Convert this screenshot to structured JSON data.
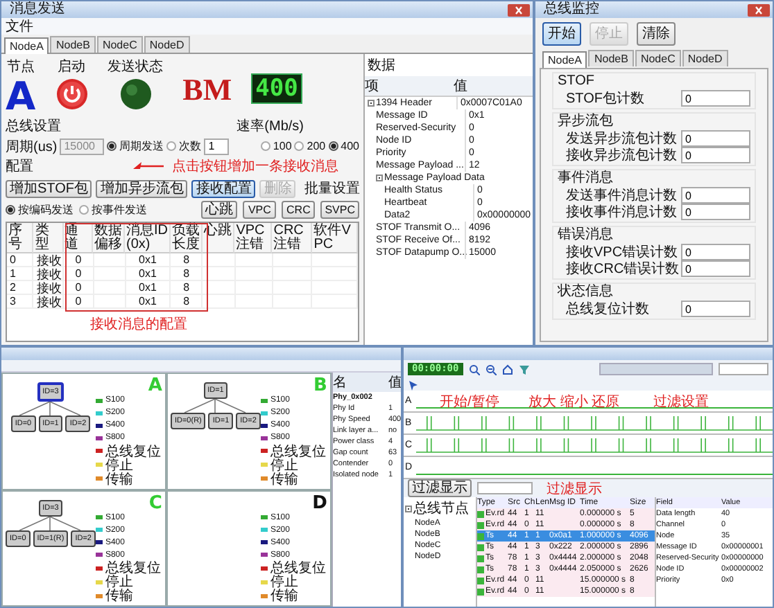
{
  "sender": {
    "title": "消息发送",
    "menu": [
      "文件"
    ],
    "tabs": [
      {
        "label": "NodeA",
        "selected": true
      },
      {
        "label": "NodeB",
        "selected": false
      },
      {
        "label": "NodeC",
        "selected": false
      },
      {
        "label": "NodeD",
        "selected": false
      }
    ],
    "status": {
      "node_label": "节点",
      "node": "A",
      "start_label": "启动",
      "send_label": "发送状态",
      "sending": true,
      "mode": "BM",
      "speed": "400"
    },
    "bus_settings": {
      "title": "总线设置",
      "period_label": "周期(us)",
      "period": "15000",
      "send_modes": [
        {
          "label": "周期发送",
          "selected": true
        },
        {
          "label": "次数",
          "selected": false
        }
      ],
      "count": "1",
      "rate_title": "速率(Mb/s)",
      "rates": [
        {
          "label": "100",
          "selected": false
        },
        {
          "label": "200",
          "selected": false
        },
        {
          "label": "400",
          "selected": true
        }
      ]
    },
    "config": {
      "title": "配置",
      "callout": "点击按钮增加一条接收消息",
      "buttons": [
        {
          "label": "增加STOF包",
          "disabled": false,
          "highlighted": false
        },
        {
          "label": "增加异步流包",
          "disabled": false,
          "highlighted": false
        },
        {
          "label": "接收配置",
          "disabled": false,
          "highlighted": true
        },
        {
          "label": "删除",
          "disabled": true,
          "highlighted": false
        }
      ],
      "modes": [
        {
          "label": "按编码发送",
          "selected": true
        },
        {
          "label": "按事件发送",
          "selected": false
        }
      ],
      "batch_title": "批量设置",
      "batch_buttons": [
        "心跳",
        "VPC",
        "CRC",
        "SVPC"
      ]
    },
    "table": {
      "columns": [
        "序号",
        "类型",
        "通道",
        "数据偏移",
        "消息ID(0x)",
        "负载长度",
        "心跳",
        "VPC注错",
        "CRC注错",
        "软件VPC"
      ],
      "rows": [
        {
          "index": "0",
          "type": "接收",
          "channel": "0",
          "message_id": "0x1",
          "length": "8"
        },
        {
          "index": "1",
          "type": "接收",
          "channel": "0",
          "message_id": "0x1",
          "length": "8"
        },
        {
          "index": "2",
          "type": "接收",
          "channel": "0",
          "message_id": "0x1",
          "length": "8"
        },
        {
          "index": "3",
          "type": "接收",
          "channel": "0",
          "message_id": "0x1",
          "length": "8"
        }
      ],
      "callout": "接收消息的配置"
    },
    "data_panel": {
      "title": "数据",
      "columns": [
        "项",
        "值"
      ],
      "rows": [
        {
          "name": "1394 Header",
          "value": "0x0007C01A0",
          "expanded": true,
          "children": [
            {
              "name": "Message ID",
              "value": "0x1"
            },
            {
              "name": "Reserved-Security",
              "value": "0"
            },
            {
              "name": "Node ID",
              "value": "0"
            },
            {
              "name": "Priority",
              "value": "0"
            },
            {
              "name": "Message Payload ...",
              "value": "12"
            },
            {
              "name": "Message Payload Data",
              "expanded": true,
              "children": [
                {
                  "name": "Health Status",
                  "value": "0"
                },
                {
                  "name": "Heartbeat",
                  "value": "0"
                },
                {
                  "name": "Data2",
                  "value": "0x00000000"
                }
              ]
            },
            {
              "name": "STOF Transmit O...",
              "value": "4096"
            },
            {
              "name": "STOF Receive Of...",
              "value": "8192"
            },
            {
              "name": "STOF Datapump O...",
              "value": "15000"
            }
          ]
        }
      ]
    }
  },
  "monitor": {
    "title": "总线监控",
    "buttons": [
      {
        "label": "开始",
        "disabled": false
      },
      {
        "label": "停止",
        "disabled": true
      },
      {
        "label": "清除",
        "disabled": false
      }
    ],
    "tabs": [
      {
        "label": "NodeA",
        "selected": true
      },
      {
        "label": "NodeB",
        "selected": false
      },
      {
        "label": "NodeC",
        "selected": false
      },
      {
        "label": "NodeD",
        "selected": false
      }
    ],
    "groups": [
      {
        "title": "STOF",
        "counters": [
          {
            "label": "STOF包计数",
            "value": "0"
          }
        ]
      },
      {
        "title": "异步流包",
        "counters": [
          {
            "label": "发送异步流包计数",
            "value": "0"
          },
          {
            "label": "接收异步流包计数",
            "value": "0"
          }
        ]
      },
      {
        "title": "事件消息",
        "counters": [
          {
            "label": "发送事件消息计数",
            "value": "0"
          },
          {
            "label": "接收事件消息计数",
            "value": "0"
          }
        ]
      },
      {
        "title": "错误消息",
        "counters": [
          {
            "label": "接收VPC错误计数",
            "value": "0"
          },
          {
            "label": "接收CRC错误计数",
            "value": "0"
          }
        ]
      },
      {
        "title": "状态信息",
        "counters": [
          {
            "label": "总线复位计数",
            "value": "0"
          }
        ]
      }
    ]
  },
  "topology": {
    "panes": [
      {
        "letter": "A",
        "color": "#33cc33",
        "root": {
          "label": "ID=3",
          "selected": true
        },
        "nodes": [
          {
            "label": "ID=0"
          },
          {
            "label": "ID=1"
          },
          {
            "label": "ID=2"
          }
        ],
        "legend": [
          {
            "label": "S100",
            "color": "#33aa33"
          },
          {
            "label": "S200",
            "color": "#33cccc"
          },
          {
            "label": "S400",
            "color": "#1a1a80"
          },
          {
            "label": "S800",
            "color": "#993399"
          },
          {
            "label": "总线复位",
            "color": "#cc2222"
          },
          {
            "label": "停止",
            "color": "#e6d84a"
          },
          {
            "label": "传输",
            "color": "#e08a2a"
          }
        ]
      },
      {
        "letter": "B",
        "color": "#33cc33",
        "root": {
          "label": "ID=1",
          "selected": false
        },
        "nodes": [
          {
            "label": "ID=0(R)"
          },
          {
            "label": "ID=1"
          },
          {
            "label": "ID=2"
          }
        ],
        "legend": [
          {
            "label": "S100",
            "color": "#33aa33"
          },
          {
            "label": "S200",
            "color": "#33cccc"
          },
          {
            "label": "S400",
            "color": "#1a1a80"
          },
          {
            "label": "S800",
            "color": "#993399"
          },
          {
            "label": "总线复位",
            "color": "#cc2222"
          },
          {
            "label": "停止",
            "color": "#e6d84a"
          },
          {
            "label": "传输",
            "color": "#e08a2a"
          }
        ]
      },
      {
        "letter": "C",
        "color": "#33cc33",
        "root": {
          "label": "ID=3",
          "selected": false
        },
        "nodes": [
          {
            "label": "ID=0"
          },
          {
            "label": "ID=1(R)"
          },
          {
            "label": "ID=2"
          }
        ],
        "legend": [
          {
            "label": "S100",
            "color": "#33aa33"
          },
          {
            "label": "S200",
            "color": "#33cccc"
          },
          {
            "label": "S400",
            "color": "#1a1a80"
          },
          {
            "label": "S800",
            "color": "#993399"
          },
          {
            "label": "总线复位",
            "color": "#cc2222"
          },
          {
            "label": "停止",
            "color": "#e6d84a"
          },
          {
            "label": "传输",
            "color": "#e08a2a"
          }
        ]
      },
      {
        "letter": "D",
        "color": "#111111",
        "legend": [
          {
            "label": "S100",
            "color": "#33aa33"
          },
          {
            "label": "S200",
            "color": "#33cccc"
          },
          {
            "label": "S400",
            "color": "#1a1a80"
          },
          {
            "label": "S800",
            "color": "#993399"
          },
          {
            "label": "总线复位",
            "color": "#cc2222"
          },
          {
            "label": "停止",
            "color": "#e6d84a"
          },
          {
            "label": "传输",
            "color": "#e08a2a"
          }
        ]
      }
    ],
    "properties": {
      "columns": [
        "名",
        "值"
      ],
      "group": "Phy_0x002",
      "rows": [
        {
          "name": "Phy Id",
          "value": "1"
        },
        {
          "name": "Phy Speed",
          "value": "400"
        },
        {
          "name": "Link layer a...",
          "value": "no"
        },
        {
          "name": "Power class",
          "value": "4"
        },
        {
          "name": "Gap count",
          "value": "63"
        },
        {
          "name": "Contender",
          "value": "0"
        },
        {
          "name": "Isolated node",
          "value": "1"
        }
      ]
    }
  },
  "analyzer": {
    "counter": "00:00:00",
    "annotations": {
      "start": "开始/暂停",
      "zoom": "放大 缩小 还原",
      "filter": "过滤设置",
      "filter_show": "过滤显示"
    },
    "lanes": [
      {
        "label": "A",
        "active": false
      },
      {
        "label": "B",
        "active": true
      },
      {
        "label": "C",
        "active": true
      },
      {
        "label": "D",
        "active": false
      }
    ],
    "filter_button": "过滤显示",
    "tree": {
      "label": "总线节点",
      "children": [
        "NodeA",
        "NodeB",
        "NodeC",
        "NodeD"
      ]
    },
    "columns": [
      "Type",
      "Src",
      "Ch",
      "Len",
      "Msg ID",
      "Time",
      "Size"
    ],
    "rows": [
      {
        "type": "Ev.rd",
        "src": "44",
        "ch": "1",
        "len": "11",
        "time": "0.000000 s",
        "size": "5",
        "selected": false
      },
      {
        "type": "Ev.rd",
        "src": "44",
        "ch": "0",
        "len": "11",
        "time": "0.000000 s",
        "size": "8",
        "selected": false
      },
      {
        "type": "Ts",
        "src": "44",
        "ch": "1",
        "len": "1",
        "id": "0x0a1",
        "time": "1.000000 s",
        "size": "4096",
        "selected": true
      },
      {
        "type": "Ts",
        "src": "44",
        "ch": "1",
        "len": "3",
        "id": "0x222",
        "time": "2.000000 s",
        "size": "2896",
        "selected": false
      },
      {
        "type": "Ts",
        "src": "78",
        "ch": "1",
        "len": "3",
        "id": "0x4444",
        "time": "2.000000 s",
        "size": "2048",
        "selected": false
      },
      {
        "type": "Ts",
        "src": "78",
        "ch": "1",
        "len": "3",
        "id": "0x4444",
        "time": "2.050000 s",
        "size": "2626",
        "selected": false
      },
      {
        "type": "Ev.rd",
        "src": "44",
        "ch": "0",
        "len": "11",
        "time": "15.000000 s",
        "size": "8",
        "selected": false
      },
      {
        "type": "Ev.rd",
        "src": "44",
        "ch": "0",
        "len": "11",
        "time": "15.000000 s",
        "size": "8",
        "selected": false
      }
    ],
    "properties": {
      "columns": [
        "Field",
        "Value"
      ],
      "rows": [
        {
          "name": "Data length",
          "value": "40"
        },
        {
          "name": "Channel",
          "value": "0"
        },
        {
          "name": "Node",
          "value": "35"
        },
        {
          "name": "Message ID",
          "value": "0x00000001"
        },
        {
          "name": "Reserved-Security",
          "value": "0x00000000"
        },
        {
          "name": "Node ID",
          "value": "0x00000002"
        },
        {
          "name": "Priority",
          "value": "0x0"
        }
      ]
    }
  }
}
